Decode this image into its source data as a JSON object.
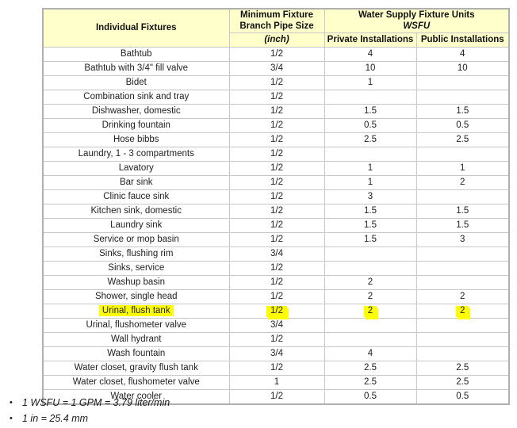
{
  "table": {
    "headers": {
      "fixture": "Individual Fixtures",
      "pipe": "Minimum Fixture Branch Pipe Size",
      "pipe_unit": "(inch)",
      "wsfu_title": "Water Supply Fixture Units",
      "wsfu_abbrev": "WSFU",
      "private": "Private Installations",
      "public": "Public Installations"
    },
    "rows": [
      {
        "fixture": "Bathtub",
        "pipe": "1/2",
        "private": "4",
        "public": "4",
        "highlight": false
      },
      {
        "fixture": "Bathtub with 3/4\" fill valve",
        "pipe": "3/4",
        "private": "10",
        "public": "10",
        "highlight": false
      },
      {
        "fixture": "Bidet",
        "pipe": "1/2",
        "private": "1",
        "public": "",
        "highlight": false
      },
      {
        "fixture": "Combination sink and tray",
        "pipe": "1/2",
        "private": "",
        "public": "",
        "highlight": false
      },
      {
        "fixture": "Dishwasher, domestic",
        "pipe": "1/2",
        "private": "1.5",
        "public": "1.5",
        "highlight": false
      },
      {
        "fixture": "Drinking fountain",
        "pipe": "1/2",
        "private": "0.5",
        "public": "0.5",
        "highlight": false
      },
      {
        "fixture": "Hose bibbs",
        "pipe": "1/2",
        "private": "2.5",
        "public": "2.5",
        "highlight": false
      },
      {
        "fixture": "Laundry, 1 - 3 compartments",
        "pipe": "1/2",
        "private": "",
        "public": "",
        "highlight": false
      },
      {
        "fixture": "Lavatory",
        "pipe": "1/2",
        "private": "1",
        "public": "1",
        "highlight": false
      },
      {
        "fixture": "Bar sink",
        "pipe": "1/2",
        "private": "1",
        "public": "2",
        "highlight": false
      },
      {
        "fixture": "Clinic fauce sink",
        "pipe": "1/2",
        "private": "3",
        "public": "",
        "highlight": false
      },
      {
        "fixture": "Kitchen sink, domestic",
        "pipe": "1/2",
        "private": "1.5",
        "public": "1.5",
        "highlight": false
      },
      {
        "fixture": "Laundry sink",
        "pipe": "1/2",
        "private": "1.5",
        "public": "1.5",
        "highlight": false
      },
      {
        "fixture": "Service or mop basin",
        "pipe": "1/2",
        "private": "1.5",
        "public": "3",
        "highlight": false
      },
      {
        "fixture": "Sinks, flushing rim",
        "pipe": "3/4",
        "private": "",
        "public": "",
        "highlight": false
      },
      {
        "fixture": "Sinks, service",
        "pipe": "1/2",
        "private": "",
        "public": "",
        "highlight": false
      },
      {
        "fixture": "Washup basin",
        "pipe": "1/2",
        "private": "2",
        "public": "",
        "highlight": false
      },
      {
        "fixture": "Shower, single head",
        "pipe": "1/2",
        "private": "2",
        "public": "2",
        "highlight": false
      },
      {
        "fixture": "Urinal, flush tank",
        "pipe": "1/2",
        "private": "2",
        "public": "2",
        "highlight": true
      },
      {
        "fixture": "Urinal, flushometer valve",
        "pipe": "3/4",
        "private": "",
        "public": "",
        "highlight": false
      },
      {
        "fixture": "Wall hydrant",
        "pipe": "1/2",
        "private": "",
        "public": "",
        "highlight": false
      },
      {
        "fixture": "Wash fountain",
        "pipe": "3/4",
        "private": "4",
        "public": "",
        "highlight": false
      },
      {
        "fixture": "Water closet, gravity flush tank",
        "pipe": "1/2",
        "private": "2.5",
        "public": "2.5",
        "highlight": false
      },
      {
        "fixture": "Water closet, flushometer valve",
        "pipe": "1",
        "private": "2.5",
        "public": "2.5",
        "highlight": false
      },
      {
        "fixture": "Water cooler",
        "pipe": "1/2",
        "private": "0.5",
        "public": "0.5",
        "highlight": false
      }
    ]
  },
  "notes": [
    "1 WSFU = 1 GPM = 3.79 liter/min",
    "1 in = 25.4 mm"
  ],
  "colors": {
    "header_background": "#ffffcc",
    "highlight": "#ffff00",
    "table_border": "#b0b0b0",
    "cell_border": "#c8c8c8"
  }
}
